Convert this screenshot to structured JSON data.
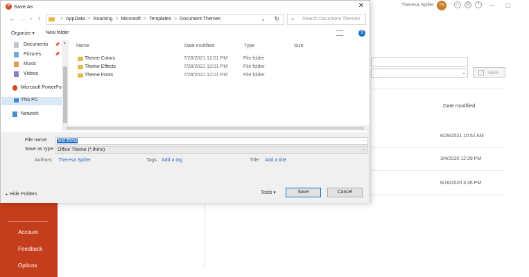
{
  "background": {
    "user_name": "Theresa Spiller",
    "user_initials": "TS",
    "left_menu": [
      "Account",
      "Feedback",
      "Options"
    ],
    "save_button": "Save",
    "list_header": "Date modified",
    "dates": [
      "6/29/2021 10:52 AM",
      "3/4/2020 12:39 PM",
      "6/16/2020 3:36 PM"
    ],
    "title_icons": [
      "☺",
      "☹",
      "?"
    ],
    "window_controls": [
      "—",
      "▢"
    ]
  },
  "dialog": {
    "title": "Save As",
    "close": "✕",
    "nav": {
      "back": "←",
      "forward": "→",
      "recent": "⌄",
      "up": "↑",
      "breadcrumbs": [
        "AppData",
        "Roaming",
        "Microsoft",
        "Templates",
        "Document Themes"
      ],
      "crumb_separator": ">",
      "dropdown": "⌄",
      "refresh": "↻",
      "search_placeholder": "Search Document Themes",
      "search_icon": "⌕"
    },
    "toolbar": {
      "organize": "Organize ▾",
      "new_folder": "New folder",
      "help": "?"
    },
    "nav_pane": [
      {
        "label": "Documents",
        "pinned": true,
        "icon": "documents-icon"
      },
      {
        "label": "Pictures",
        "pinned": true,
        "icon": "pictures-icon"
      },
      {
        "label": "Music",
        "pinned": false,
        "icon": "music-icon"
      },
      {
        "label": "Videos",
        "pinned": false,
        "icon": "videos-icon"
      },
      {
        "label": "Microsoft PowerPo",
        "pinned": false,
        "icon": "powerpoint-icon"
      },
      {
        "label": "This PC",
        "pinned": false,
        "selected": true,
        "icon": "this-pc-icon"
      },
      {
        "label": "Network",
        "pinned": false,
        "icon": "network-icon"
      }
    ],
    "pin_glyph": "📌",
    "columns": [
      "Name",
      "Date modified",
      "Type",
      "Size"
    ],
    "files": [
      {
        "name": "Theme Colors",
        "date": "7/28/2021 12:01 PM",
        "type": "File folder"
      },
      {
        "name": "Theme Effects",
        "date": "7/28/2021 12:01 PM",
        "type": "File folder"
      },
      {
        "name": "Theme Fonts",
        "date": "7/28/2021 12:01 PM",
        "type": "File folder"
      }
    ],
    "file_name_label": "File name:",
    "file_name_value": "test.thmx",
    "save_type_label": "Save as type:",
    "save_type_value": "Office Theme (*.thmx)",
    "authors_label": "Authors:",
    "authors_value": "Theresa Spiller",
    "tags_label": "Tags:",
    "tags_value": "Add a tag",
    "title_label": "Title:",
    "title_value": "Add a title",
    "hide_folders": "Hide Folders",
    "hide_folders_glyph": "▲",
    "tools": "Tools ▾",
    "save": "Save",
    "cancel": "Cancel",
    "dropdown_glyph": "⌄"
  }
}
